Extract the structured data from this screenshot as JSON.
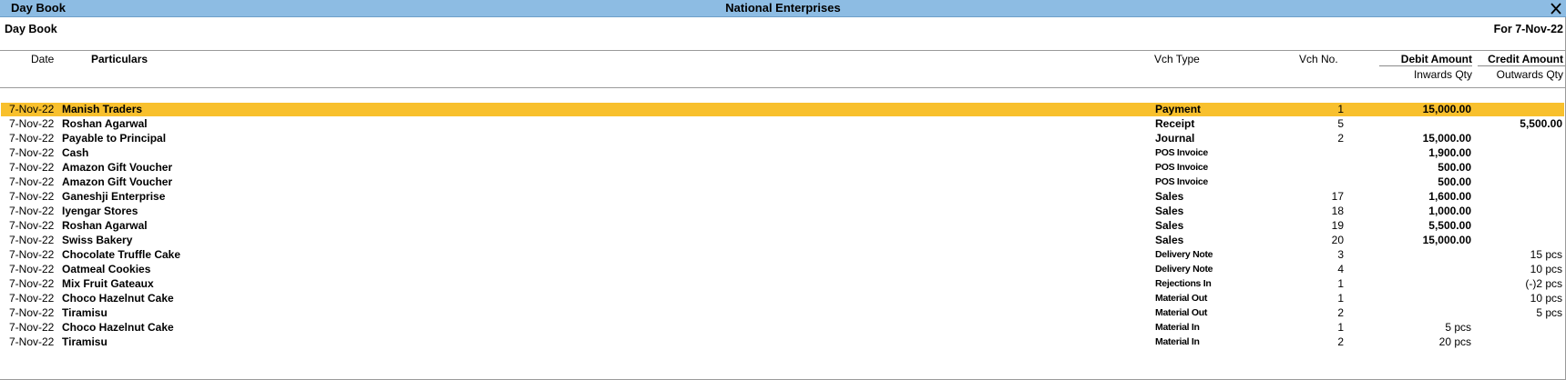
{
  "window": {
    "screen_name": "Day Book",
    "company": "National Enterprises",
    "close_icon": "close-icon"
  },
  "report": {
    "title": "Day Book",
    "period": "For 7-Nov-22"
  },
  "columns": {
    "date": "Date",
    "particulars": "Particulars",
    "vch_type": "Vch Type",
    "vch_no": "Vch No.",
    "debit": "Debit Amount",
    "credit": "Credit Amount",
    "inwards": "Inwards Qty",
    "outwards": "Outwards Qty"
  },
  "colors": {
    "titlebar": "#8dbce3",
    "selected_row": "#f8c02d"
  },
  "rows": [
    {
      "date": "7-Nov-22",
      "particulars": "Manish Traders",
      "vch_type": "Payment",
      "vch_no": "1",
      "debit": "15,000.00",
      "credit": "",
      "selected": true
    },
    {
      "date": "7-Nov-22",
      "particulars": "Roshan Agarwal",
      "vch_type": "Receipt",
      "vch_no": "5",
      "debit": "",
      "credit": "5,500.00"
    },
    {
      "date": "7-Nov-22",
      "particulars": "Payable to Principal",
      "vch_type": "Journal",
      "vch_no": "2",
      "debit": "15,000.00",
      "credit": ""
    },
    {
      "date": "7-Nov-22",
      "particulars": "Cash",
      "vch_type": "POS Invoice",
      "vch_no": "",
      "debit": "1,900.00",
      "credit": ""
    },
    {
      "date": "7-Nov-22",
      "particulars": "Amazon Gift Voucher",
      "vch_type": "POS Invoice",
      "vch_no": "",
      "debit": "500.00",
      "credit": ""
    },
    {
      "date": "7-Nov-22",
      "particulars": "Amazon Gift Voucher",
      "vch_type": "POS Invoice",
      "vch_no": "",
      "debit": "500.00",
      "credit": ""
    },
    {
      "date": "7-Nov-22",
      "particulars": "Ganeshji Enterprise",
      "vch_type": "Sales",
      "vch_no": "17",
      "debit": "1,600.00",
      "credit": ""
    },
    {
      "date": "7-Nov-22",
      "particulars": "Iyengar Stores",
      "vch_type": "Sales",
      "vch_no": "18",
      "debit": "1,000.00",
      "credit": ""
    },
    {
      "date": "7-Nov-22",
      "particulars": "Roshan Agarwal",
      "vch_type": "Sales",
      "vch_no": "19",
      "debit": "5,500.00",
      "credit": ""
    },
    {
      "date": "7-Nov-22",
      "particulars": "Swiss Bakery",
      "vch_type": "Sales",
      "vch_no": "20",
      "debit": "15,000.00",
      "credit": ""
    },
    {
      "date": "7-Nov-22",
      "particulars": "Chocolate Truffle Cake",
      "vch_type": "Delivery Note",
      "vch_no": "3",
      "debit": "",
      "credit": "15 pcs"
    },
    {
      "date": "7-Nov-22",
      "particulars": "Oatmeal Cookies",
      "vch_type": "Delivery Note",
      "vch_no": "4",
      "debit": "",
      "credit": "10 pcs"
    },
    {
      "date": "7-Nov-22",
      "particulars": "Mix Fruit Gateaux",
      "vch_type": "Rejections In",
      "vch_no": "1",
      "debit": "",
      "credit": "(-)2 pcs"
    },
    {
      "date": "7-Nov-22",
      "particulars": "Choco Hazelnut Cake",
      "vch_type": "Material Out",
      "vch_no": "1",
      "debit": "",
      "credit": "10 pcs"
    },
    {
      "date": "7-Nov-22",
      "particulars": "Tiramisu",
      "vch_type": "Material Out",
      "vch_no": "2",
      "debit": "",
      "credit": "5 pcs"
    },
    {
      "date": "7-Nov-22",
      "particulars": "Choco Hazelnut Cake",
      "vch_type": "Material In",
      "vch_no": "1",
      "debit": "5 pcs",
      "credit": ""
    },
    {
      "date": "7-Nov-22",
      "particulars": "Tiramisu",
      "vch_type": "Material In",
      "vch_no": "2",
      "debit": "20 pcs",
      "credit": ""
    }
  ]
}
